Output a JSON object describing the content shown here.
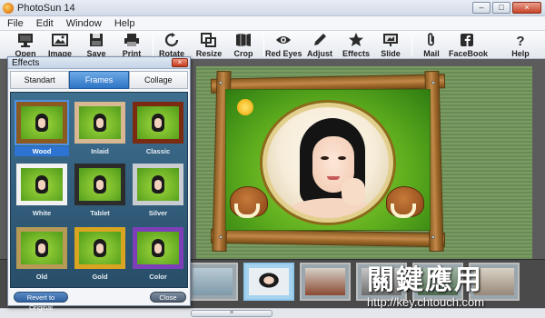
{
  "window": {
    "title": "PhotoSun 14",
    "controls": [
      "–",
      "□",
      "×"
    ]
  },
  "menu": [
    "File",
    "Edit",
    "Window",
    "Help"
  ],
  "toolbar": {
    "open": "Open",
    "image": "Image",
    "save": "Save",
    "print": "Print",
    "rotate": "Rotate",
    "resize": "Resize",
    "crop": "Crop",
    "red_eyes": "Red Eyes",
    "adjust": "Adjust",
    "effects": "Effects",
    "slide": "Slide",
    "mail": "Mail",
    "facebook": "FaceBook",
    "help": "Help"
  },
  "effects_panel": {
    "title": "Effects",
    "close_glyph": "×",
    "tabs": [
      "Standart",
      "Frames",
      "Collage"
    ],
    "active_tab": "Frames",
    "frames": [
      {
        "label": "Wood",
        "selected": true,
        "color": "#8b5a20"
      },
      {
        "label": "Inlaid",
        "selected": false,
        "color": "#d7b892"
      },
      {
        "label": "Classic",
        "selected": false,
        "color": "#7a2b12"
      },
      {
        "label": "White",
        "selected": false,
        "color": "#f2f2f2"
      },
      {
        "label": "Tablet",
        "selected": false,
        "color": "#2c2c2c"
      },
      {
        "label": "Silver",
        "selected": false,
        "color": "#c9cdd2"
      },
      {
        "label": "Old",
        "selected": false,
        "color": "#b79a55"
      },
      {
        "label": "Gold",
        "selected": false,
        "color": "#d9a520"
      },
      {
        "label": "Color",
        "selected": false,
        "color": "#7d3fb8"
      }
    ],
    "revert_button": "Revert to Original",
    "close_button": "Close"
  },
  "watermark": {
    "cjk": "關鍵應用",
    "url": "http://key.chtouch.com"
  },
  "scrollbar": {
    "grip": "≡"
  },
  "colors": {
    "accent": "#2c73d2",
    "toolbar_bg": "#e4e8ee",
    "canvas_bg": "#5c5c5c"
  }
}
